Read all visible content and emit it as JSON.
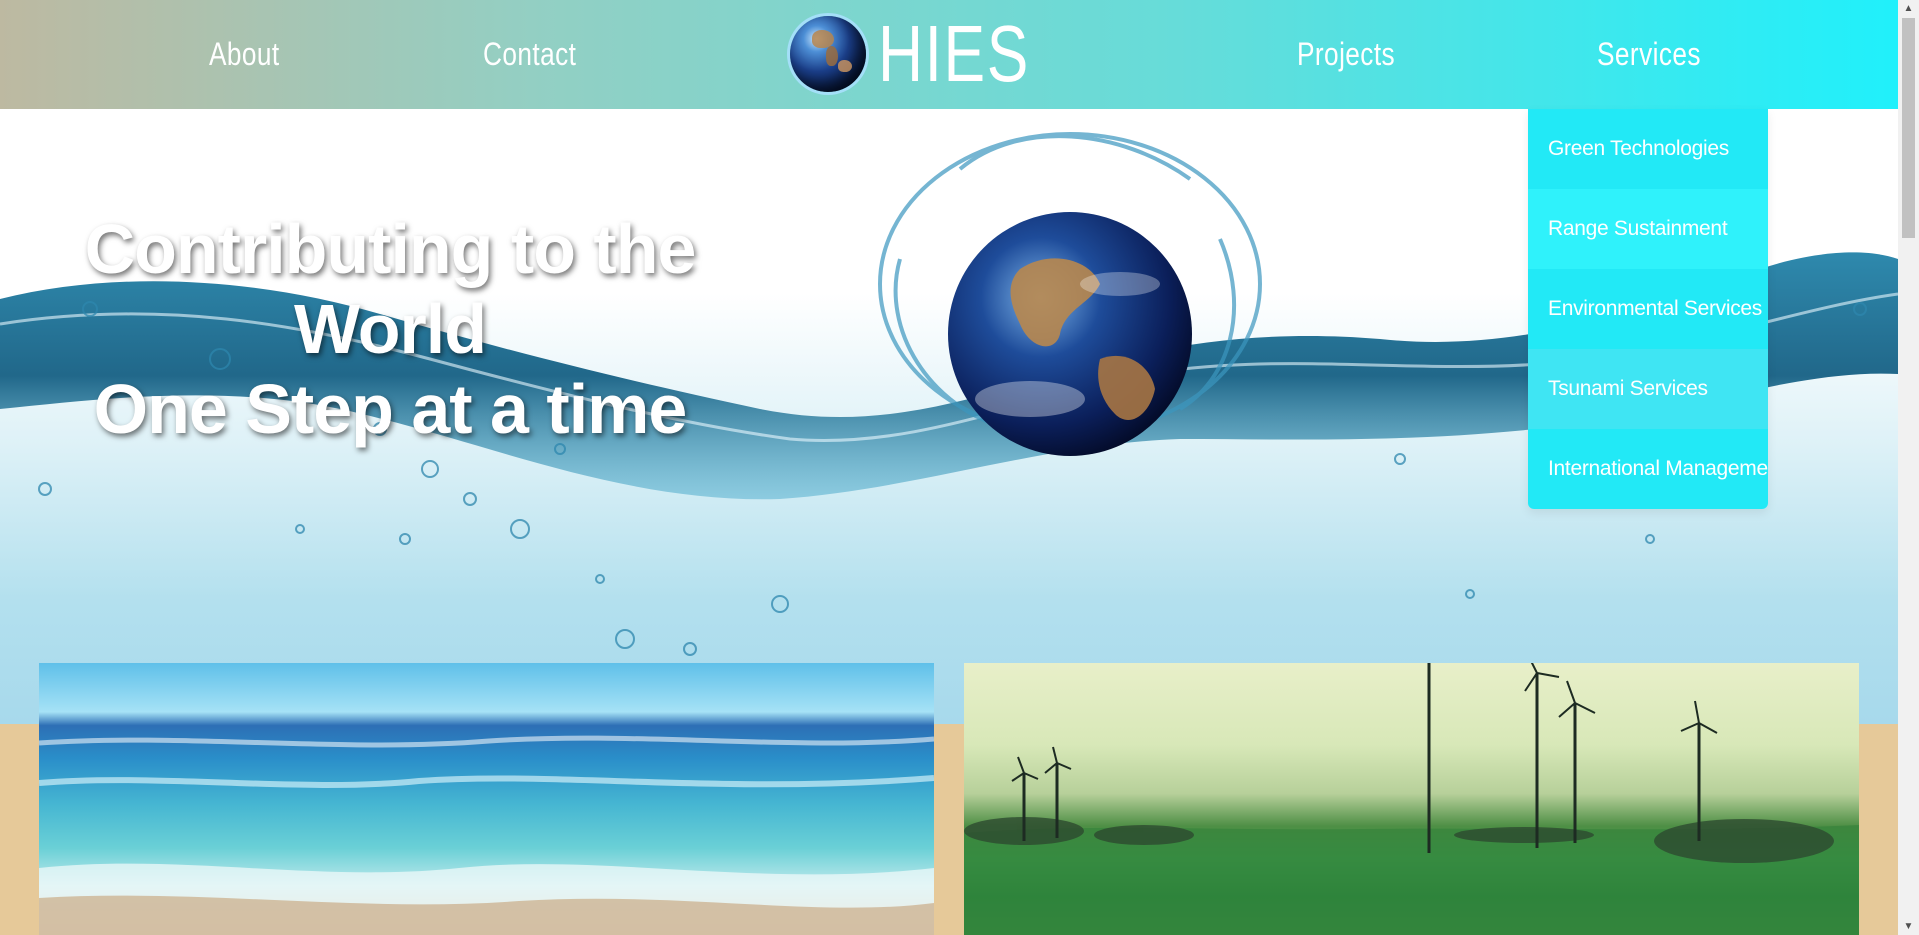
{
  "nav": {
    "about": "About",
    "contact": "Contact",
    "brand": "HIES",
    "projects": "Projects",
    "services": "Services"
  },
  "hero": {
    "line1": "Contributing to the World",
    "line2": "One Step at a time"
  },
  "services_menu": [
    "Green Technologies",
    "Range Sustainment",
    "Environmental Services",
    "Tsunami Services",
    "International Management"
  ],
  "colors": {
    "nav_gradient_start": "#bdb9a1",
    "nav_gradient_end": "#20f0fb",
    "dropdown": "#22e9f6",
    "page_background": "#e6c999"
  },
  "icons": {
    "logo": "earth-globe-icon",
    "scroll_up": "triangle-up-icon",
    "scroll_down": "triangle-down-icon"
  }
}
